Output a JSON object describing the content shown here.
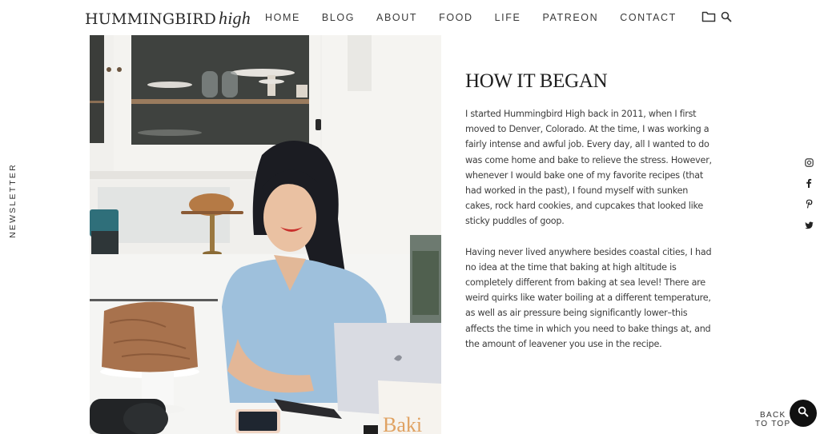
{
  "header": {
    "logo_main": "HUMMINGBIRD",
    "logo_italic": "high",
    "nav": [
      {
        "label": "HOME"
      },
      {
        "label": "BLOG"
      },
      {
        "label": "ABOUT"
      },
      {
        "label": "FOOD"
      },
      {
        "label": "LIFE"
      },
      {
        "label": "PATREON"
      },
      {
        "label": "CONTACT"
      }
    ],
    "icons": [
      "folder-icon",
      "search-icon"
    ]
  },
  "photo": {
    "description": "Woman smiling at a laptop in a white kitchen with a frosted chocolate cake, camera, phone and a baking book",
    "book_text": "Baki"
  },
  "article": {
    "title": "HOW IT BEGAN",
    "paragraphs": [
      "I started Hummingbird High back in 2011, when I first moved to Denver, Colorado. At the time, I was working a fairly intense and awful job. Every day, all I wanted to do was come home and bake to relieve the stress. However, whenever I would bake one of my favorite recipes (that had worked in the past), I found myself with sunken cakes, rock hard cookies, and cupcakes that looked like sticky puddles of goop.",
      "Having never lived anywhere besides coastal cities, I had no idea at the time that baking at high altitude is completely different from baking at sea level! There are weird quirks like water boiling at a different temperature, as well as air pressure being significantly lower–this affects the time in which you need to bake things at, and the amount of leavener you use in the recipe."
    ]
  },
  "sidebar": {
    "newsletter_label": "NEWSLETTER"
  },
  "social": [
    {
      "name": "instagram",
      "icon": "instagram-icon"
    },
    {
      "name": "facebook",
      "icon": "facebook-icon"
    },
    {
      "name": "pinterest",
      "icon": "pinterest-icon"
    },
    {
      "name": "twitter",
      "icon": "twitter-icon"
    }
  ],
  "footer": {
    "back_to_top_line1": "BACK",
    "back_to_top_line2": "TO TOP",
    "fab_icon": "search-icon"
  },
  "colors": {
    "text": "#333333",
    "heading": "#1e1e1e",
    "fab_background": "#111111",
    "shirt": "#9ec0dc",
    "cake": "#a8724d"
  }
}
